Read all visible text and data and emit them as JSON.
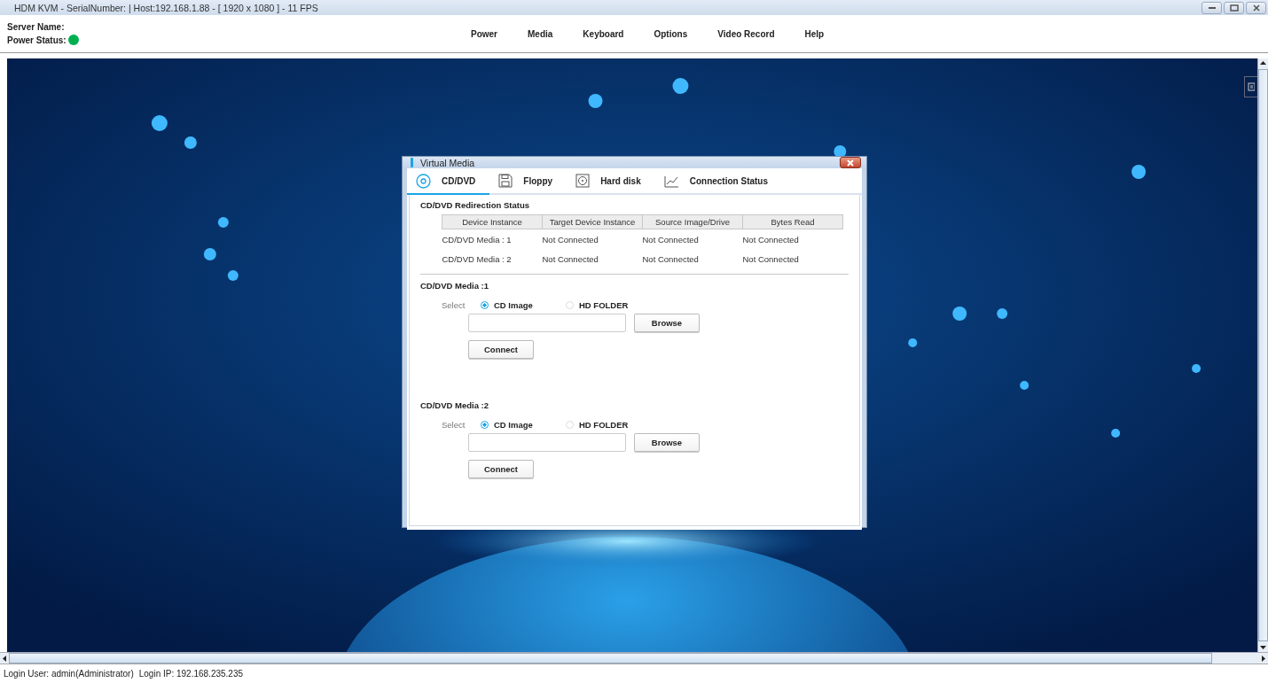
{
  "window": {
    "title": "HDM KVM - SerialNumber: | Host:192.168.1.88 - [ 1920 x 1080 ] - 11 FPS"
  },
  "header": {
    "server_name_label": "Server Name:",
    "power_status_label": "Power Status:",
    "power_on": true
  },
  "menu": [
    "Power",
    "Media",
    "Keyboard",
    "Options",
    "Video Record",
    "Help"
  ],
  "dialog": {
    "title": "Virtual Media",
    "tabs": [
      {
        "label": "CD/DVD",
        "selected": true,
        "kind": "disc"
      },
      {
        "label": "Floppy",
        "selected": false,
        "kind": "floppy"
      },
      {
        "label": "Hard disk",
        "selected": false,
        "kind": "harddisk"
      },
      {
        "label": "Connection Status",
        "selected": false,
        "kind": "chart"
      }
    ],
    "status_title": "CD/DVD Redirection Status",
    "table": {
      "columns": [
        "Device Instance",
        "Target Device Instance",
        "Source Image/Drive",
        "Bytes Read"
      ],
      "rows": [
        [
          "CD/DVD Media : 1",
          "Not Connected",
          "Not Connected",
          "Not Connected"
        ],
        [
          "CD/DVD Media : 2",
          "Not Connected",
          "Not Connected",
          "Not Connected"
        ]
      ]
    },
    "media": [
      {
        "title": "CD/DVD Media :1",
        "select_label": "Select",
        "options": [
          {
            "label": "CD Image",
            "selected": true
          },
          {
            "label": "HD FOLDER",
            "selected": false
          }
        ],
        "browse": "Browse",
        "connect": "Connect"
      },
      {
        "title": "CD/DVD Media :2",
        "select_label": "Select",
        "options": [
          {
            "label": "CD Image",
            "selected": true
          },
          {
            "label": "HD FOLDER",
            "selected": false
          }
        ],
        "browse": "Browse",
        "connect": "Connect"
      }
    ]
  },
  "status_bar": {
    "login_user": "Login User: admin(Administrator)",
    "login_ip": "Login IP: 192.168.235.235"
  }
}
